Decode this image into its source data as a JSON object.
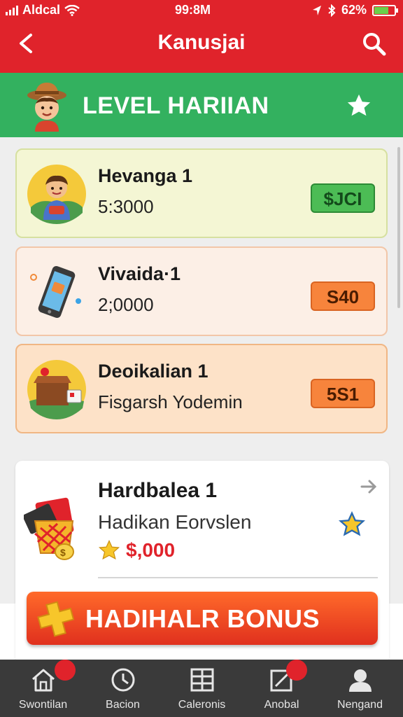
{
  "status_bar": {
    "carrier": "Aldcal",
    "time": "99:8M",
    "battery": "62%"
  },
  "header": {
    "title": "Kanusjai",
    "back_icon": "back-arrow-icon",
    "search_icon": "search-icon"
  },
  "banner": {
    "title": "LEVEL HARIIAN"
  },
  "tasks": [
    {
      "title": "Hevanga 1",
      "subtitle": "5:3000",
      "reward": "$JCI"
    },
    {
      "title": "Vivaida·1",
      "subtitle": "2;0000",
      "reward": "S40"
    },
    {
      "title": "Deoikalian 1",
      "subtitle": "Fisgarsh Yodemin",
      "reward": "5S1"
    }
  ],
  "reward_card": {
    "title": "Hardbalea 1",
    "subtitle": "Hadikan Eorvslen",
    "amount": "$,000"
  },
  "bonus_button": {
    "label": "HADIHALR BONUS"
  },
  "bottom_nav": [
    {
      "label": "Swontilan",
      "icon": "home-icon"
    },
    {
      "label": "Bacion",
      "icon": "clock-icon"
    },
    {
      "label": "Caleronis",
      "icon": "grid-icon"
    },
    {
      "label": "Anobal",
      "icon": "edit-icon"
    },
    {
      "label": "Nengand",
      "icon": "profile-icon"
    }
  ],
  "colors": {
    "header_red": "#e0232b",
    "banner_green": "#33b15f",
    "bonus_orange": "#f0481f",
    "nav_dark": "#3a3a3a"
  }
}
